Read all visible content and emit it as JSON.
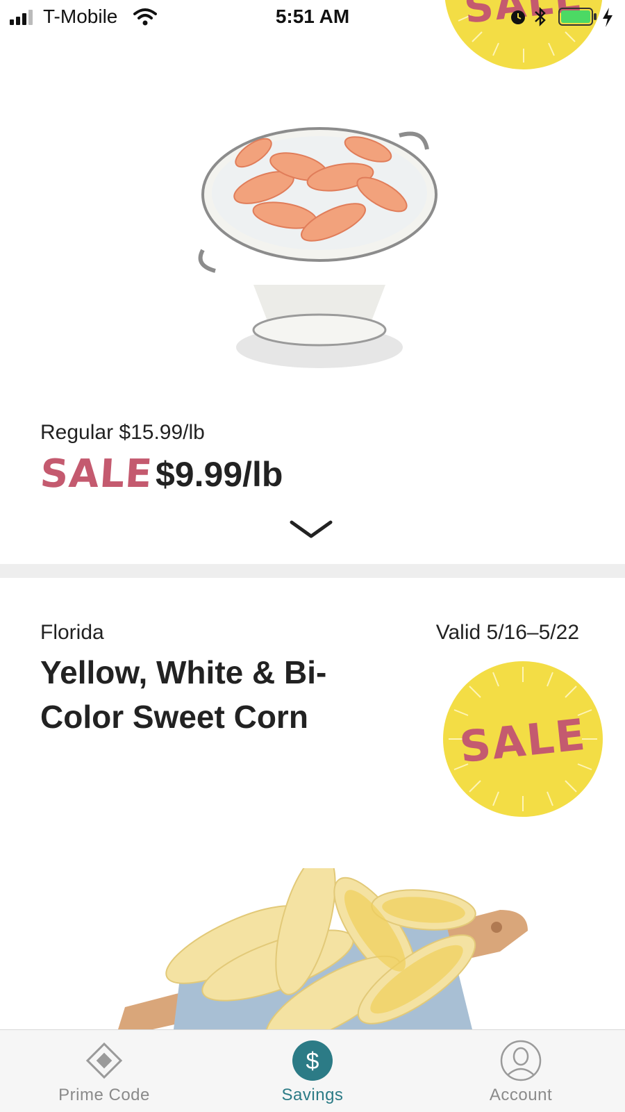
{
  "status_bar": {
    "carrier": "T-Mobile",
    "time": "5:51 AM",
    "icons": [
      "signal-icon",
      "wifi-icon",
      "alarm-icon",
      "bluetooth-icon",
      "battery-icon",
      "charging-icon"
    ]
  },
  "badge_text": "SALE",
  "items": [
    {
      "image": "shrimp-in-colander",
      "regular_price": "Regular $15.99/lb",
      "sale_label": "SALE",
      "sale_price": "$9.99/lb",
      "expand_icon": "chevron-down-icon"
    },
    {
      "origin": "Florida",
      "valid": "Valid 5/16–5/22",
      "title": "Yellow, White & Bi-Color Sweet Corn",
      "badge": "SALE",
      "image": "corn-on-cutting-board"
    }
  ],
  "tabs": [
    {
      "label": "Prime Code",
      "icon": "diamond-icon",
      "active": false
    },
    {
      "label": "Savings",
      "icon": "dollar-icon",
      "active": true
    },
    {
      "label": "Account",
      "icon": "user-icon",
      "active": false
    }
  ],
  "colors": {
    "sale_text": "#c45a6f",
    "badge_yellow": "#f3dd45",
    "accent_teal": "#2c7b86",
    "divider": "#eeeeee"
  }
}
